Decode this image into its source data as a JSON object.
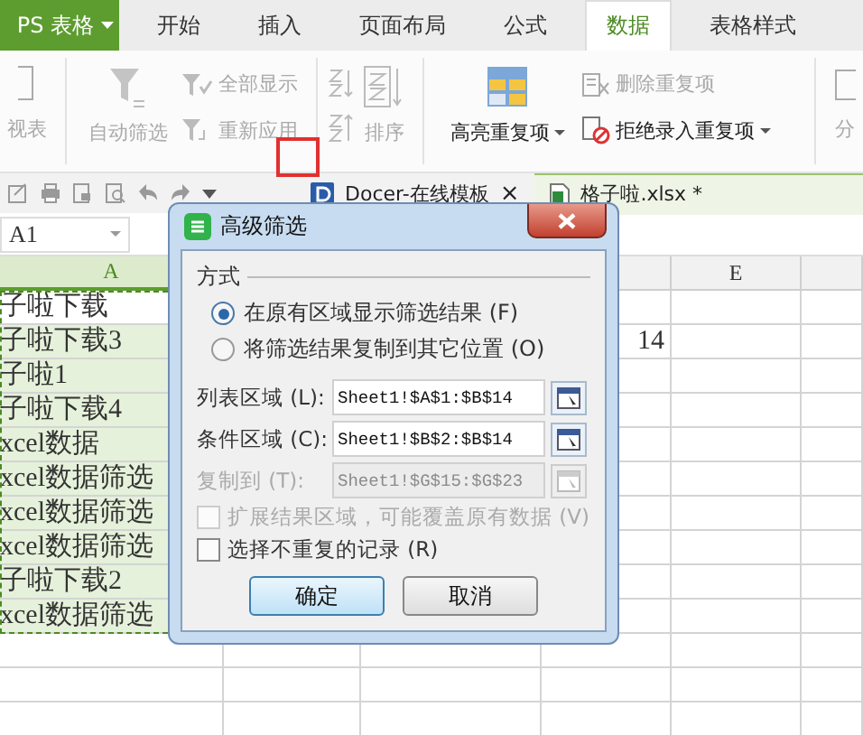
{
  "app_menu": {
    "label": "PS 表格"
  },
  "ribbon_tabs": [
    {
      "label": "开始",
      "selected": false
    },
    {
      "label": "插入",
      "selected": false
    },
    {
      "label": "页面布局",
      "selected": false
    },
    {
      "label": "公式",
      "selected": false
    },
    {
      "label": "数据",
      "selected": true
    },
    {
      "label": "表格样式",
      "selected": false
    }
  ],
  "ribbon": {
    "pivot": {
      "label": "视表",
      "disabled": true
    },
    "auto_filter": {
      "label": "自动筛选",
      "disabled": true
    },
    "show_all": {
      "label": "全部显示",
      "disabled": true
    },
    "reapply": {
      "label": "重新应用",
      "disabled": true
    },
    "sort": {
      "label": "排序",
      "disabled": true
    },
    "highlight_duplicates": {
      "label": "高亮重复项",
      "disabled": false
    },
    "remove_duplicates": {
      "label": "删除重复项",
      "disabled": true
    },
    "reject_duplicates": {
      "label": "拒绝录入重复项",
      "disabled": false
    },
    "split": {
      "label": "分",
      "disabled": true
    }
  },
  "document_tabs": [
    {
      "label": "Docer-在线模板",
      "selected": false,
      "close": "×"
    },
    {
      "label": "格子啦.xlsx *",
      "selected": true
    }
  ],
  "name_box": "A1",
  "column_headers": {
    "a": {
      "label": "A",
      "selected": true
    },
    "e": {
      "label": "E",
      "selected": false
    }
  },
  "rows": [
    {
      "a": "子啦下载",
      "active": true
    },
    {
      "a": "子啦下载3",
      "d": "14",
      "active": false
    },
    {
      "a": "子啦1",
      "active": false
    },
    {
      "a": "子啦下载4",
      "active": false
    },
    {
      "a": "xcel数据",
      "active": false
    },
    {
      "a": "xcel数据筛选",
      "active": false
    },
    {
      "a": "xcel数据筛选",
      "active": false
    },
    {
      "a": "xcel数据筛选",
      "active": false
    },
    {
      "a": "子啦下载2",
      "active": false
    },
    {
      "a": "xcel数据筛选",
      "active": false
    }
  ],
  "dialog": {
    "title": "高级筛选",
    "group": "方式",
    "radios": [
      {
        "label": "在原有区域显示筛选结果 (F)",
        "selected": true
      },
      {
        "label": "将筛选结果复制到其它位置 (O)",
        "selected": false
      }
    ],
    "fields": [
      {
        "label": "列表区域 (L):",
        "value": "Sheet1!$A$1:$B$14",
        "disabled": false
      },
      {
        "label": "条件区域 (C):",
        "value": "Sheet1!$B$2:$B$14",
        "disabled": false
      },
      {
        "label": "复制到 (T):",
        "value": "Sheet1!$G$15:$G$23",
        "disabled": true
      }
    ],
    "checkboxes": [
      {
        "label": "扩展结果区域，可能覆盖原有数据 (V)",
        "checked": false,
        "disabled": true
      },
      {
        "label": "选择不重复的记录 (R)",
        "checked": false,
        "disabled": false
      }
    ],
    "buttons": [
      {
        "label": "确定",
        "default": true
      },
      {
        "label": "取消",
        "default": false
      }
    ]
  }
}
